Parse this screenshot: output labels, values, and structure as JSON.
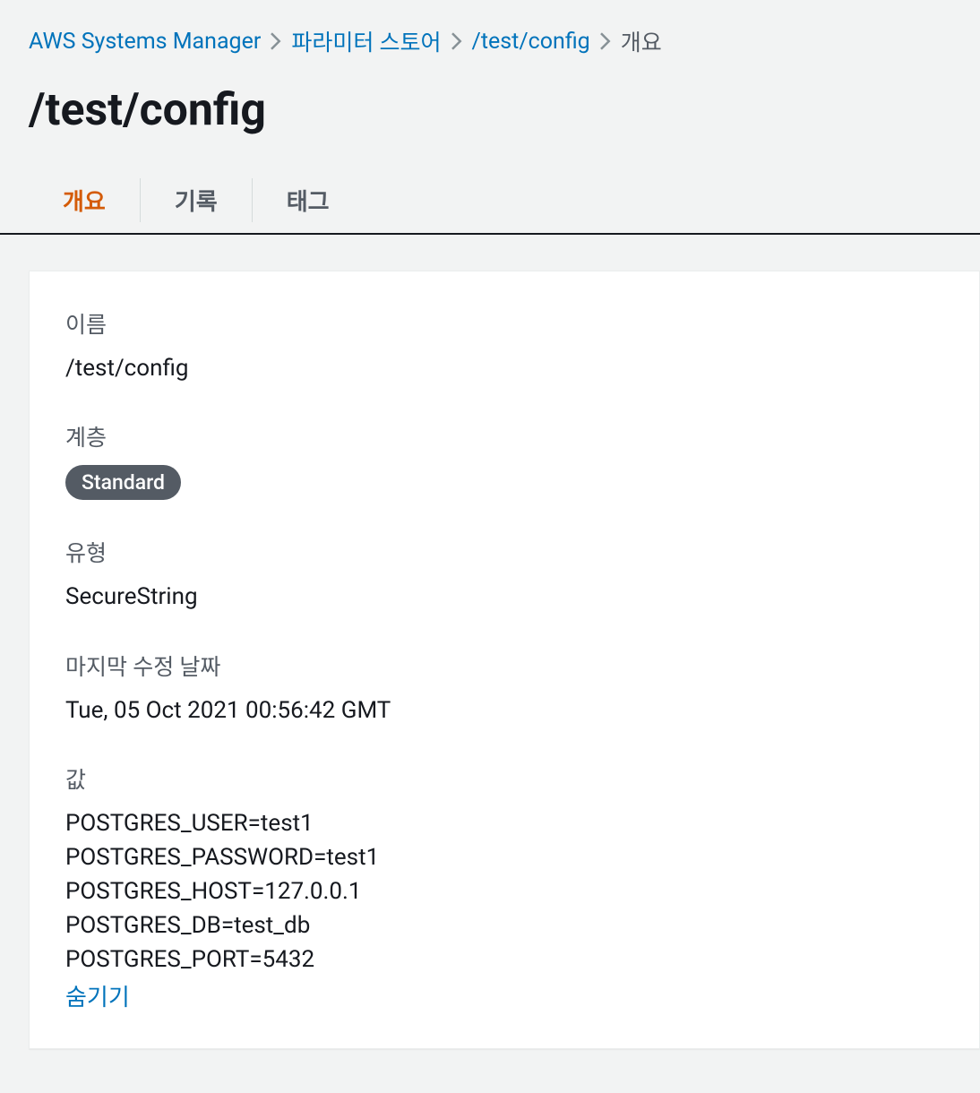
{
  "breadcrumb": {
    "items": [
      {
        "label": "AWS Systems Manager",
        "type": "link"
      },
      {
        "label": "파라미터 스토어",
        "type": "link"
      },
      {
        "label": "/test/config",
        "type": "link"
      },
      {
        "label": "개요",
        "type": "current"
      }
    ]
  },
  "page": {
    "title": "/test/config"
  },
  "tabs": [
    {
      "label": "개요",
      "active": true
    },
    {
      "label": "기록",
      "active": false
    },
    {
      "label": "태그",
      "active": false
    }
  ],
  "fields": {
    "name": {
      "label": "이름",
      "value": "/test/config"
    },
    "tier": {
      "label": "계층",
      "value": "Standard"
    },
    "type": {
      "label": "유형",
      "value": "SecureString"
    },
    "last_modified": {
      "label": "마지막 수정 날짜",
      "value": "Tue, 05 Oct 2021 00:56:42 GMT"
    },
    "value": {
      "label": "값",
      "value": "POSTGRES_USER=test1\nPOSTGRES_PASSWORD=test1\nPOSTGRES_HOST=127.0.0.1\nPOSTGRES_DB=test_db\nPOSTGRES_PORT=5432",
      "hide_label": "숨기기"
    }
  }
}
